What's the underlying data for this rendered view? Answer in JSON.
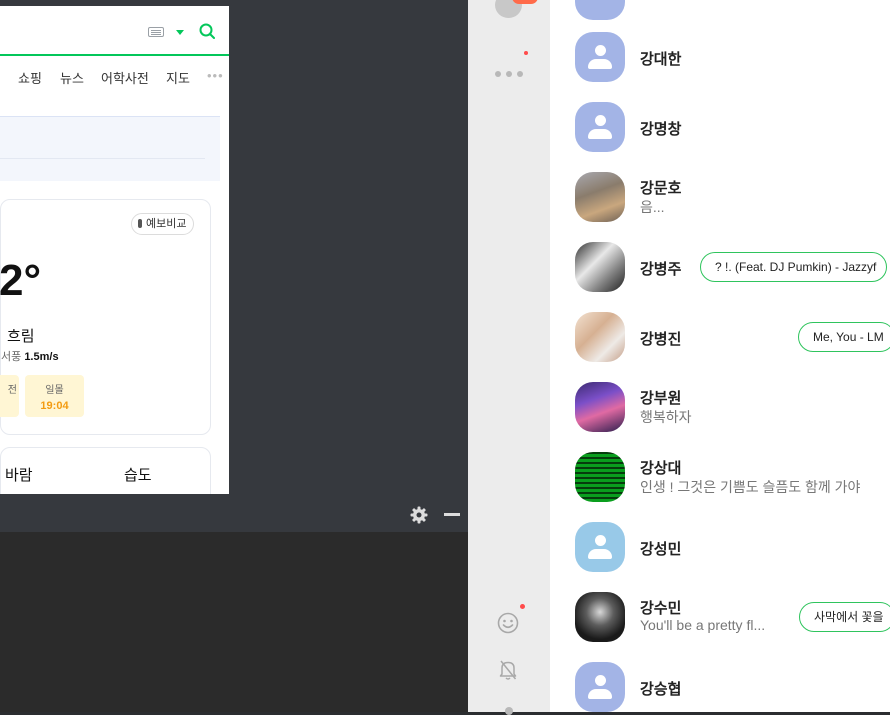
{
  "browser": {
    "nav_tabs": [
      "쇼핑",
      "뉴스",
      "어학사전",
      "지도"
    ],
    "nav_more": "•••",
    "weather": {
      "compare_label": "예보비교",
      "temperature": "2°",
      "condition": "흐림",
      "wind_direction": "서풍",
      "wind_speed": "1.5m/s",
      "sunset_partial": "전",
      "sunset_label": "일몰",
      "sunset_time": "19:04"
    },
    "detail_headers": [
      "바람",
      "습도"
    ]
  },
  "taskbar": {
    "gear_label": "settings",
    "minimize_label": "minimize"
  },
  "friends": [
    {
      "name": "강대한",
      "status": "",
      "music": ""
    },
    {
      "name": "강명창",
      "status": "",
      "music": ""
    },
    {
      "name": "강문호",
      "status": "음...",
      "music": ""
    },
    {
      "name": "강병주",
      "status": "",
      "music": "? !. (Feat. DJ Pumkin) - Jazzyf"
    },
    {
      "name": "강병진",
      "status": "",
      "music": "Me, You - LM"
    },
    {
      "name": "강부원",
      "status": "행복하자",
      "music": ""
    },
    {
      "name": "강상대",
      "status": "인생 ! 그것은 기쁨도 슬픔도 함께 가야",
      "music": ""
    },
    {
      "name": "강성민",
      "status": "",
      "music": ""
    },
    {
      "name": "강수민",
      "status": "You'll be a pretty fl...",
      "music": "사막에서 꽃을"
    },
    {
      "name": "강승협",
      "status": "",
      "music": ""
    }
  ],
  "colors": {
    "naver_green": "#03c75a",
    "music_border": "#2fc45d",
    "badge_red": "#ff4b4b",
    "default_avatar": "#a3b4e6"
  }
}
